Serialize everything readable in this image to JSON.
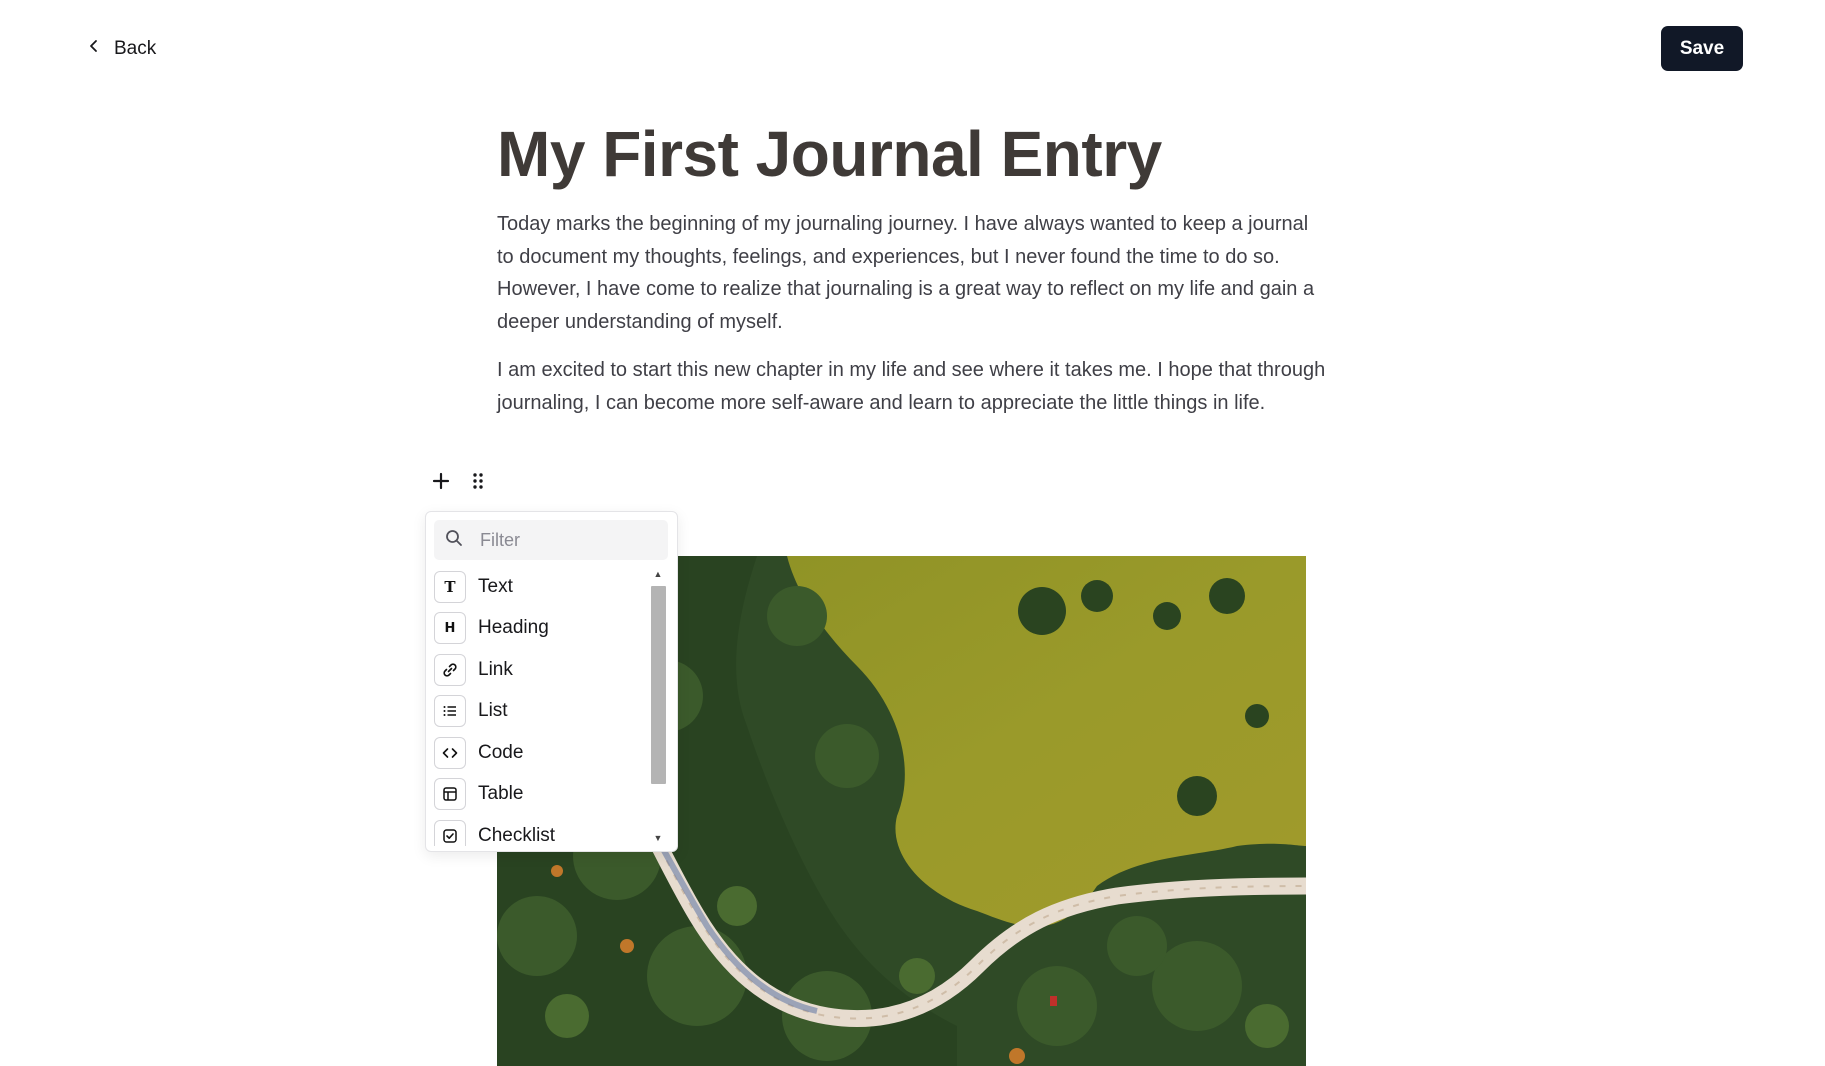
{
  "header": {
    "back_label": "Back",
    "save_label": "Save"
  },
  "entry": {
    "title": "My First Journal Entry",
    "paragraphs": [
      "Today marks the beginning of my journaling journey. I have always wanted to keep a journal to document my thoughts, feelings, and experiences, but I never found the time to do so. However, I have come to realize that journaling is a great way to reflect on my life and gain a deeper understanding of myself.",
      "I am excited to start this new chapter in my life and see where it takes me. I hope that through journaling, I can become more self-aware and learn to appreciate the little things in life."
    ]
  },
  "block_menu": {
    "filter_placeholder": "Filter",
    "items": [
      {
        "label": "Text",
        "icon": "text-type-icon"
      },
      {
        "label": "Heading",
        "icon": "heading-icon"
      },
      {
        "label": "Link",
        "icon": "link-icon"
      },
      {
        "label": "List",
        "icon": "list-icon"
      },
      {
        "label": "Code",
        "icon": "code-icon"
      },
      {
        "label": "Table",
        "icon": "table-icon"
      },
      {
        "label": "Checklist",
        "icon": "checklist-icon"
      }
    ]
  },
  "colors": {
    "save_button_bg": "#111827",
    "title_text": "#3f3a37",
    "body_text": "#3f3f46"
  }
}
